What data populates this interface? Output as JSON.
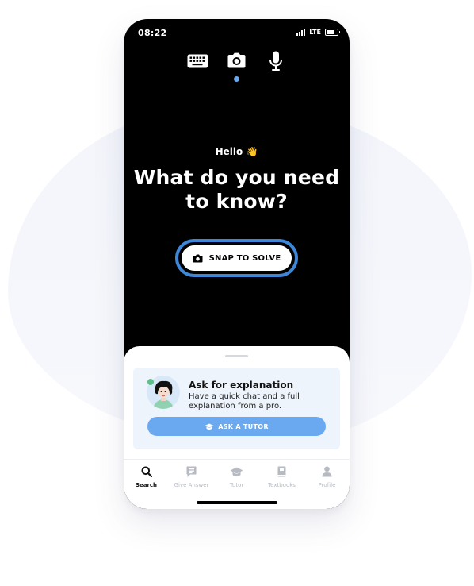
{
  "status_bar": {
    "time": "08:22",
    "network": "LTE"
  },
  "input_modes": {
    "items": [
      "keyboard",
      "camera",
      "microphone"
    ],
    "active": "camera"
  },
  "main": {
    "greeting": "Hello 👋",
    "headline": "What do you need to know?",
    "snap_button_label": "SNAP TO SOLVE"
  },
  "explanation_card": {
    "title": "Ask for explanation",
    "description": "Have a quick chat and a full explanation from a pro.",
    "button_label": "ASK A TUTOR"
  },
  "bottom_nav": {
    "items": [
      {
        "label": "Search",
        "icon": "search-icon",
        "active": true
      },
      {
        "label": "Give Answer",
        "icon": "answer-icon",
        "active": false
      },
      {
        "label": "Tutor",
        "icon": "graduation-cap-icon",
        "active": false
      },
      {
        "label": "Textbooks",
        "icon": "book-icon",
        "active": false
      },
      {
        "label": "Profile",
        "icon": "profile-icon",
        "active": false
      }
    ]
  },
  "colors": {
    "accent_blue": "#3d86d8",
    "button_blue": "#6aa9f0",
    "card_bg": "#edf4fc",
    "screen_bg": "#000000"
  }
}
